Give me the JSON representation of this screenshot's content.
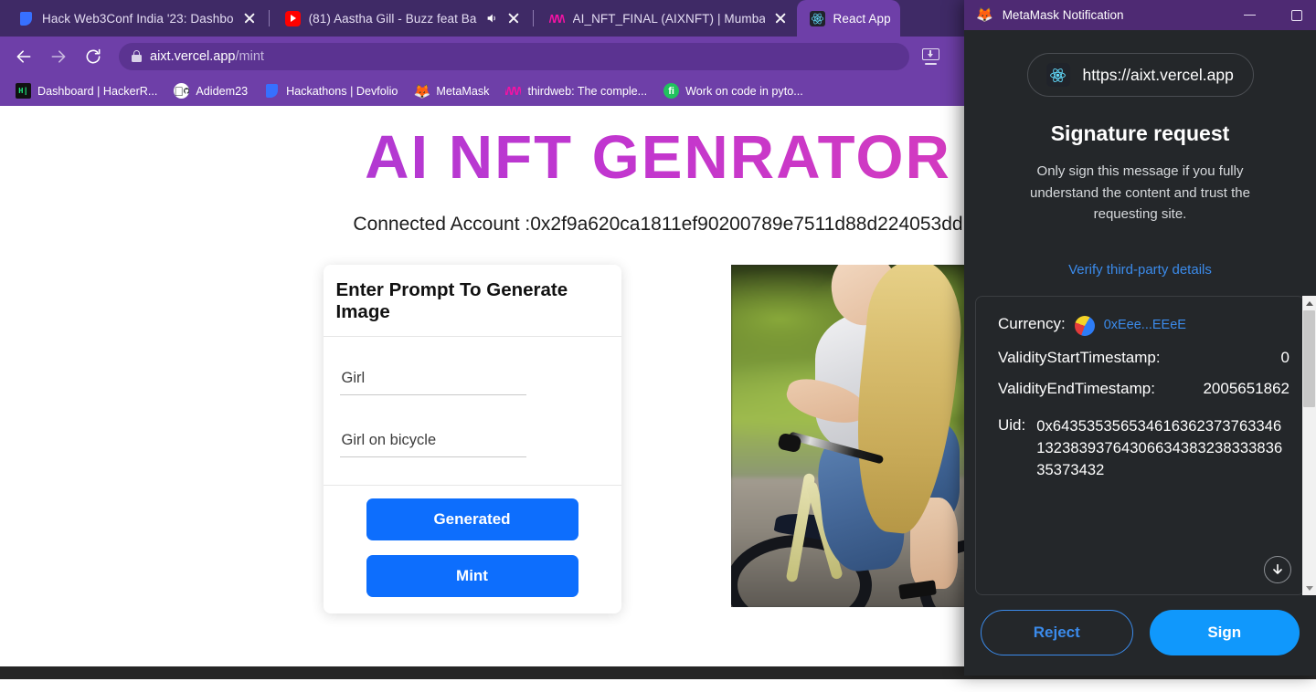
{
  "browser": {
    "tabs": [
      {
        "title": "Hack Web3Conf India '23: Dashbo",
        "favicon": "devfolio-icon",
        "active": false,
        "muted": false
      },
      {
        "title": "(81) Aastha Gill - Buzz feat Ba",
        "favicon": "youtube-icon",
        "active": false,
        "muted": true
      },
      {
        "title": "AI_NFT_FINAL (AIXNFT) | Mumbai",
        "favicon": "thirdweb-icon",
        "active": false,
        "muted": false
      },
      {
        "title": "React App",
        "favicon": "react-icon",
        "active": true,
        "muted": false
      }
    ],
    "nav": {
      "back_label": "←",
      "forward_label": "→",
      "reload_label": "⟳"
    },
    "omnibox": {
      "domain": "aixt.vercel.app",
      "path": "/mint",
      "lock_icon": "lock-icon"
    },
    "toolbar_right": {
      "download_icon": "download-icon"
    },
    "bookmarks": [
      {
        "label": "Dashboard | HackerR...",
        "favicon": "hackerrank-icon"
      },
      {
        "label": "Adidem23",
        "favicon": "github-icon"
      },
      {
        "label": "Hackathons | Devfolio",
        "favicon": "devfolio-icon"
      },
      {
        "label": "MetaMask",
        "favicon": "metamask-fox-icon"
      },
      {
        "label": "thirdweb: The comple...",
        "favicon": "thirdweb-icon"
      },
      {
        "label": "Work on code in pyto...",
        "favicon": "green-circle-icon"
      }
    ]
  },
  "page": {
    "title": "AI NFT GENRATOR",
    "connected_account_label": "Connected Account :0x2f9a620ca1811ef90200789e7511d88d224053dd",
    "card": {
      "header": "Enter Prompt To Generate Image",
      "fields": [
        {
          "name": "name",
          "value": "Girl",
          "placeholder": "Girl"
        },
        {
          "name": "prompt",
          "value": "Girl on bicycle",
          "placeholder": "Girl on bicycle"
        }
      ],
      "generate_button": "Generated",
      "mint_button": "Mint"
    },
    "nft_image_alt": "generated-nft-girl-on-bicycle"
  },
  "metamask": {
    "window_title": "MetaMask Notification",
    "window_controls": {
      "minimize": "minimize-icon",
      "maximize": "maximize-icon"
    },
    "site_url": "https://aixt.vercel.app",
    "heading": "Signature request",
    "description": "Only sign this message if you fully understand the content and trust the requesting site.",
    "verify_link": "Verify third-party details",
    "details": {
      "currency_label": "Currency:",
      "currency_value": "0xEee...EEeE",
      "validity_start_label": "ValidityStartTimestamp:",
      "validity_start_value": "0",
      "validity_end_label": "ValidityEndTimestamp:",
      "validity_end_value": "2005651862",
      "uid_label": "Uid:",
      "uid_value": "0x6435353565346163623737633461323839376430663438323833383635373432"
    },
    "scroll_down_icon": "arrow-down-circle-icon",
    "reject_button": "Reject",
    "sign_button": "Sign"
  }
}
